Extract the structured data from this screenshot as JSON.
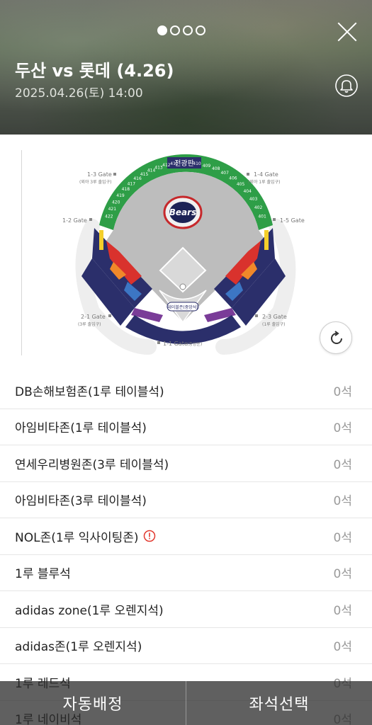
{
  "header": {
    "title": "두산 vs 롯데 (4.26)",
    "datetime": "2025.04.26(토) 14:00",
    "pagination": {
      "total": 4,
      "active": 1
    }
  },
  "stadium": {
    "team_logo_text": "Bears",
    "scoreboard_label": "전광판",
    "gates": {
      "g13": "1-3 Gate",
      "g13_sub": "(외야 3루 출입구)",
      "g14": "1-4 Gate",
      "g14_sub": "(외야 1루 출입구)",
      "g12": "1-2 Gate",
      "g15": "1-5 Gate",
      "g21": "2-1 Gate",
      "g21_sub": "(3루 출입구)",
      "g23": "2-3 Gate",
      "g23_sub": "(1루 출입구)",
      "g11": "1-1 Gate",
      "g11_sub": "(중앙문)",
      "home_zone": "테이블존(중앙석)"
    },
    "outfield_left_sections": [
      "422",
      "421",
      "420",
      "419",
      "418",
      "417",
      "416",
      "415",
      "414",
      "413",
      "412",
      "411"
    ],
    "outfield_right_sections": [
      "410",
      "409",
      "408",
      "407",
      "406",
      "405",
      "404",
      "403",
      "402",
      "401"
    ],
    "colors": {
      "outfield": "#2e9e47",
      "navy": "#2b2f6b",
      "red": "#d9322d",
      "orange": "#f0882a",
      "blue": "#3c76c4",
      "purple": "#7a3c98",
      "yellow": "#f4cf2b",
      "infield": "#bdbdbd"
    }
  },
  "seats": [
    {
      "name": "DB손해보험존(1루 테이블석)",
      "count": "0석"
    },
    {
      "name": "아임비타존(1루 테이블석)",
      "count": "0석"
    },
    {
      "name": "연세우리병원존(3루 테이블석)",
      "count": "0석"
    },
    {
      "name": "아임비타존(3루 테이블석)",
      "count": "0석"
    },
    {
      "name": "NOL존(1루 익사이팅존)",
      "count": "0석",
      "warning": true
    },
    {
      "name": "1루 블루석",
      "count": "0석"
    },
    {
      "name": "adidas zone(1루 오렌지석)",
      "count": "0석"
    },
    {
      "name": "adidas존(1루 오렌지석)",
      "count": "0석"
    },
    {
      "name": "1루 레드석",
      "count": "0석"
    },
    {
      "name": "1루 네이비석",
      "count": "0석"
    }
  ],
  "actions": {
    "auto_assign": "자동배정",
    "select_seat": "좌석선택"
  }
}
